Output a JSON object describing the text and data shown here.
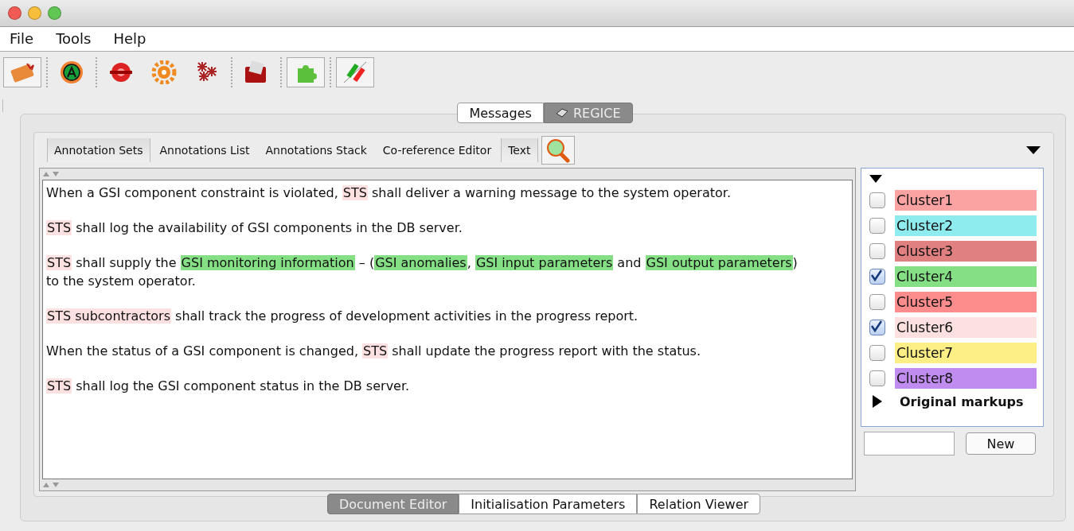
{
  "menu": [
    "File",
    "Tools",
    "Help"
  ],
  "toolbar": [
    {
      "pressed": true
    },
    {
      "pressed": false
    },
    {
      "pressed": false
    },
    {
      "pressed": false
    },
    {
      "pressed": false
    },
    {
      "pressed": false
    },
    {
      "pressed": true
    },
    {
      "pressed": true
    }
  ],
  "top_tabs": [
    {
      "label": "Messages",
      "selected": false
    },
    {
      "label": "REGICE",
      "selected": true
    }
  ],
  "view_tabs": [
    {
      "label": "Annotation Sets",
      "pressed": true
    },
    {
      "label": "Annotations List",
      "pressed": false
    },
    {
      "label": "Annotations Stack",
      "pressed": false
    },
    {
      "label": "Co-reference Editor",
      "pressed": false
    },
    {
      "label": "Text",
      "pressed": true
    }
  ],
  "document": [
    [
      [
        {
          "text": "When a GSI component constraint is violated, "
        },
        {
          "text": "STS",
          "color": "#fde0e0"
        },
        {
          "text": " shall deliver a warning message to the system operator."
        }
      ]
    ],
    [
      [
        {
          "text": "STS",
          "color": "#fde0e0"
        },
        {
          "text": " shall log the availability of GSI components in the DB server."
        }
      ]
    ],
    [
      [
        {
          "text": "STS",
          "color": "#fde0e0"
        },
        {
          "text": " shall supply the "
        },
        {
          "text": "GSI monitoring information",
          "color": "#85e085"
        },
        {
          "text": " – ("
        },
        {
          "text": "GSI anomalies",
          "color": "#85e085"
        },
        {
          "text": ", "
        },
        {
          "text": "GSI input parameters",
          "color": "#85e085"
        },
        {
          "text": " and "
        },
        {
          "text": "GSI output parameters",
          "color": "#85e085"
        },
        {
          "text": ")"
        }
      ],
      [
        {
          "text": "to the system operator."
        }
      ]
    ],
    [
      [
        {
          "text": "STS subcontractors",
          "color": "#fde0e0"
        },
        {
          "text": " shall track the progress of development activities in the progress report."
        }
      ]
    ],
    [
      [
        {
          "text": "When the status of a GSI component is changed, "
        },
        {
          "text": "STS",
          "color": "#fde0e0"
        },
        {
          "text": " shall update the progress report with the status."
        }
      ]
    ],
    [
      [
        {
          "text": "STS",
          "color": "#fde0e0"
        },
        {
          "text": " shall log the GSI component status in the DB server."
        }
      ]
    ]
  ],
  "clusters": [
    {
      "label": "Cluster1",
      "checked": false,
      "color": "#fba3a3"
    },
    {
      "label": "Cluster2",
      "checked": false,
      "color": "#8eecee"
    },
    {
      "label": "Cluster3",
      "checked": false,
      "color": "#e08080"
    },
    {
      "label": "Cluster4",
      "checked": true,
      "color": "#85e085"
    },
    {
      "label": "Cluster5",
      "checked": false,
      "color": "#fd8c8c"
    },
    {
      "label": "Cluster6",
      "checked": true,
      "color": "#fde0e0"
    },
    {
      "label": "Cluster7",
      "checked": false,
      "color": "#fdee85"
    },
    {
      "label": "Cluster8",
      "checked": false,
      "color": "#c08cf0"
    }
  ],
  "original_markups": {
    "label": "Original markups",
    "expanded": false
  },
  "new_button": "New",
  "bottom_tabs": [
    {
      "label": "Document Editor",
      "selected": true
    },
    {
      "label": "Initialisation Parameters",
      "selected": false
    },
    {
      "label": "Relation Viewer",
      "selected": false
    }
  ]
}
